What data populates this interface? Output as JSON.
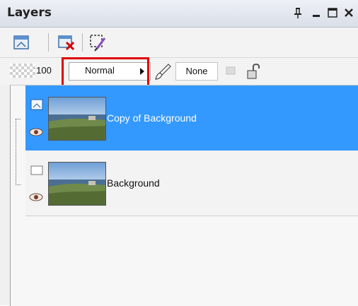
{
  "panel": {
    "title": "Layers",
    "window_controls": {
      "pin": "ᵖ",
      "minimize": "–",
      "maximize": "☐",
      "close": "×"
    }
  },
  "toolbar1": {
    "icons": [
      "new-layer-icon",
      "delete-layer-icon",
      "edit-selection-icon"
    ]
  },
  "toolbar2": {
    "opacity": "100",
    "blend_mode": "Normal",
    "mask": "None"
  },
  "layers": [
    {
      "name": "Copy of Background",
      "selected": true
    },
    {
      "name": "Background",
      "selected": false
    }
  ],
  "colors": {
    "selection": "#3399ff",
    "highlight_border": "#e00000"
  }
}
